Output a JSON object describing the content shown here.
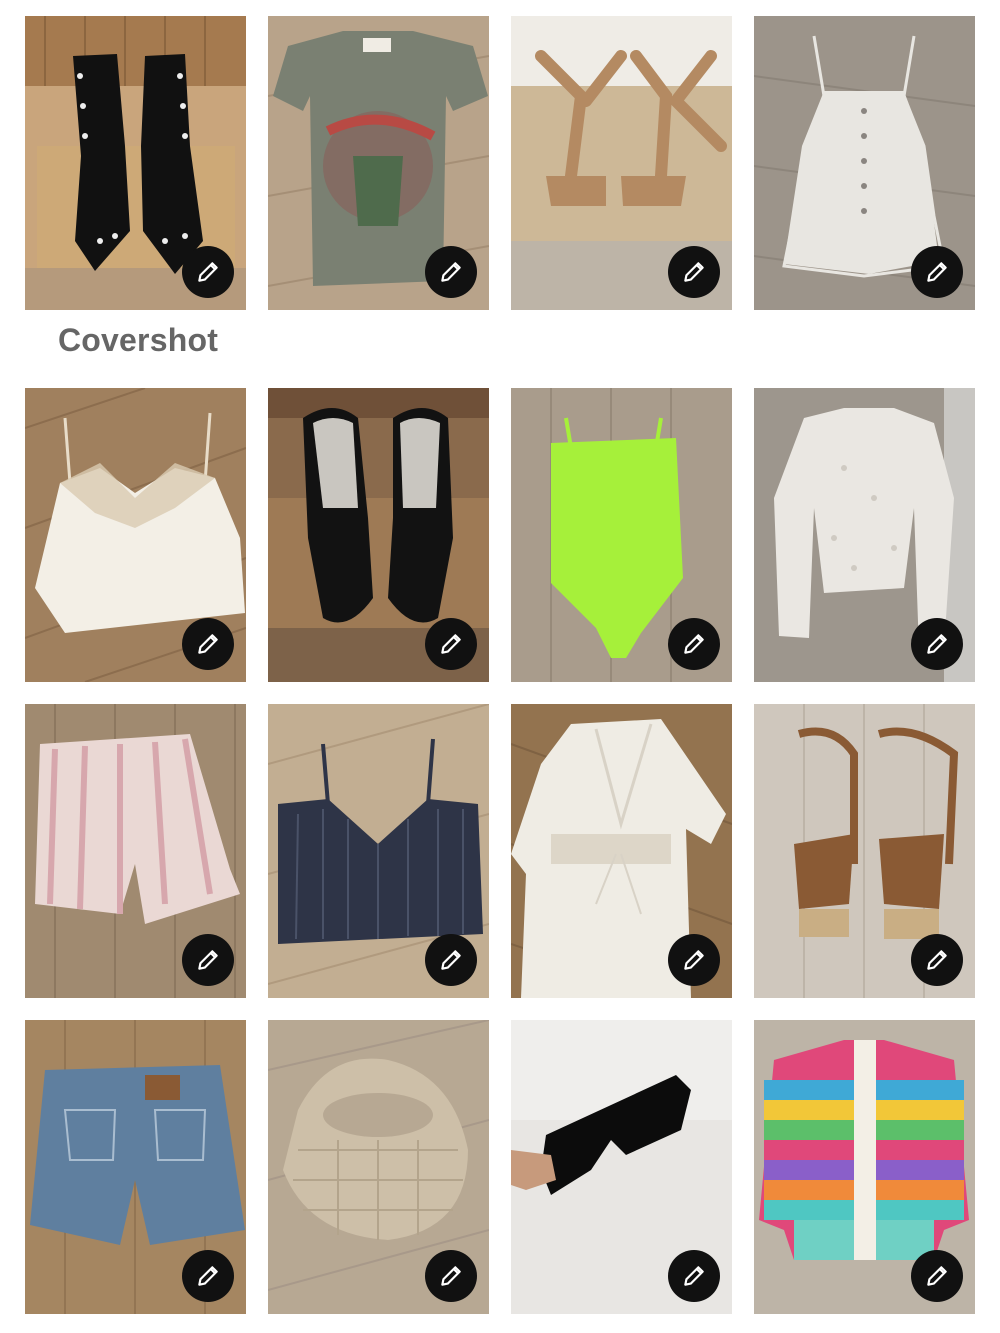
{
  "section_label": "Covershot",
  "edit_icon": "pencil-icon",
  "tiles": [
    {
      "id": "studded-black-boots",
      "bg": "#c9a57c",
      "item_color": "#111111"
    },
    {
      "id": "rolling-stones-tee",
      "bg": "#b8a38a",
      "item_color": "#7a8072"
    },
    {
      "id": "tan-suede-sandals",
      "bg": "#c7b9a4",
      "item_color": "#b48a62"
    },
    {
      "id": "white-button-romper",
      "bg": "#9c948a",
      "item_color": "#e8e6e1"
    },
    {
      "id": "satin-lace-cami",
      "bg": "#a0805e",
      "item_color": "#f3efe6"
    },
    {
      "id": "black-patent-pumps",
      "bg": "#8a6a4c",
      "item_color": "#121212"
    },
    {
      "id": "neon-green-bodysuit",
      "bg": "#a99c8c",
      "item_color": "#a6f03a"
    },
    {
      "id": "white-lace-top",
      "bg": "#9d968d",
      "item_color": "#eae7e2"
    },
    {
      "id": "striped-linen-shorts",
      "bg": "#a08a70",
      "item_color": "#ead8d4"
    },
    {
      "id": "pleated-navy-cami",
      "bg": "#c2ae92",
      "item_color": "#2e3447"
    },
    {
      "id": "white-crochet-coverup",
      "bg": "#93734f",
      "item_color": "#efece4"
    },
    {
      "id": "brown-cork-wedges",
      "bg": "#cfc7bd",
      "item_color": "#8a5a34"
    },
    {
      "id": "levis-denim-shorts",
      "bg": "#a58661",
      "item_color": "#5f7f9f"
    },
    {
      "id": "woven-leather-bag",
      "bg": "#b7a893",
      "item_color": "#cdbfa8"
    },
    {
      "id": "black-sunglasses",
      "bg": "#e8e6e3",
      "item_color": "#0c0c0c"
    },
    {
      "id": "rainbow-knit-cardigan",
      "bg": "#bdb4a7",
      "item_color": "#e0487a"
    }
  ]
}
